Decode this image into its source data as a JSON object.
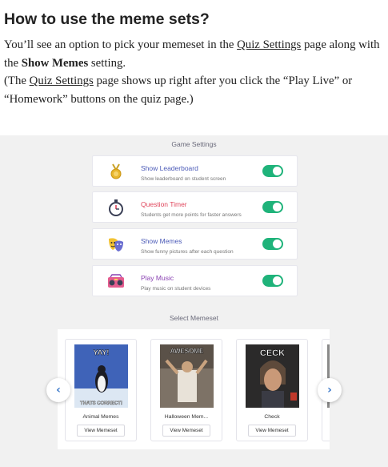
{
  "article": {
    "heading": "How to use the meme sets?",
    "line1_a": "You’ll see an option to pick your memeset in the ",
    "line1_link": "Quiz Settings",
    "line1_b": " page along with the ",
    "line1_bold": "Show Memes",
    "line1_c": " setting.",
    "line2_a": "(The ",
    "line2_link": "Quiz Settings",
    "line2_b": " page shows up right after you click the “Play Live” or “Homework” buttons on the quiz page.)"
  },
  "screenshot": {
    "game_settings_title": "Game Settings",
    "settings": [
      {
        "title": "Show Leaderboard",
        "subtitle": "Show leaderboard on student screen",
        "icon": "medal-icon",
        "enabled": true
      },
      {
        "title": "Question Timer",
        "subtitle": "Students get more points for faster answers",
        "icon": "stopwatch-icon",
        "enabled": true
      },
      {
        "title": "Show Memes",
        "subtitle": "Show funny pictures after each question",
        "icon": "theater-masks-icon",
        "enabled": true
      },
      {
        "title": "Play Music",
        "subtitle": "Play music on student devices",
        "icon": "boombox-icon",
        "enabled": true
      }
    ],
    "select_memeset_title": "Select Memeset",
    "memesets": [
      {
        "name": "Animal Memes",
        "top_caption": "YAY!",
        "bottom_caption": "THATS CORRECT!",
        "button": "View Memeset"
      },
      {
        "name": "Halloween Mem...",
        "top_caption": "AWESOME",
        "button": "View Memeset"
      },
      {
        "name": "Check",
        "top_caption": "CECK",
        "button": "View Memeset"
      }
    ],
    "prev_icon": "chevron-left-icon",
    "next_icon": "chevron-right-icon",
    "colors": {
      "toggle_on": "#1fb37a",
      "accent_blue": "#4b5ab7",
      "accent_red": "#e0465c",
      "accent_purple": "#8a42b2"
    }
  }
}
